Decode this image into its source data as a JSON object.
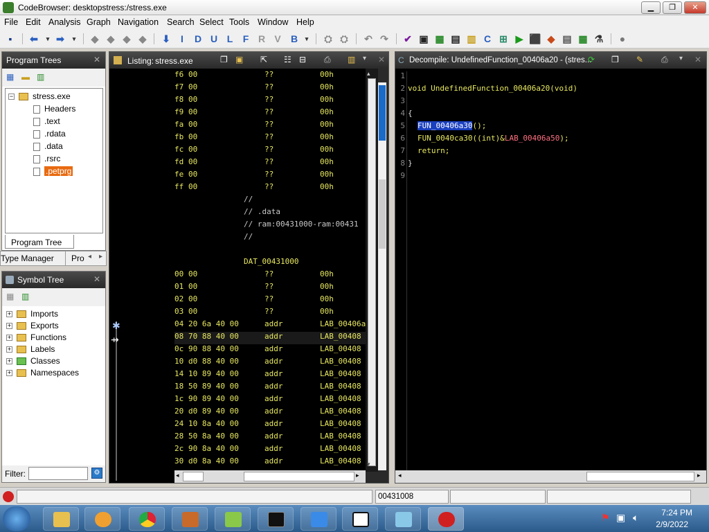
{
  "window": {
    "title": "CodeBrowser: desktopstress:/stress.exe"
  },
  "menu": [
    "File",
    "Edit",
    "Analysis",
    "Graph",
    "Navigation",
    "Search",
    "Select",
    "Tools",
    "Window",
    "Help"
  ],
  "toolbar": {
    "letter_buttons": [
      "I",
      "D",
      "U",
      "L",
      "F",
      "R",
      "V",
      "B"
    ]
  },
  "program_trees": {
    "title": "Program Trees",
    "root": "stress.exe",
    "items": [
      "Headers",
      ".text",
      ".rdata",
      ".data",
      ".rsrc",
      ".petprg"
    ],
    "tab_label": "Program Tree",
    "bottom_tabs": [
      "Type Manager",
      "Pro"
    ]
  },
  "symbol_tree": {
    "title": "Symbol Tree",
    "items": [
      "Imports",
      "Exports",
      "Functions",
      "Labels",
      "Classes",
      "Namespaces"
    ],
    "filter_label": "Filter:"
  },
  "listing": {
    "title": "Listing:",
    "file": "stress.exe",
    "rows": [
      {
        "addr": "f6",
        "bytes": "00",
        "mn": "??",
        "op": "00h"
      },
      {
        "addr": "f7",
        "bytes": "00",
        "mn": "??",
        "op": "00h"
      },
      {
        "addr": "f8",
        "bytes": "00",
        "mn": "??",
        "op": "00h"
      },
      {
        "addr": "f9",
        "bytes": "00",
        "mn": "??",
        "op": "00h"
      },
      {
        "addr": "fa",
        "bytes": "00",
        "mn": "??",
        "op": "00h"
      },
      {
        "addr": "fb",
        "bytes": "00",
        "mn": "??",
        "op": "00h"
      },
      {
        "addr": "fc",
        "bytes": "00",
        "mn": "??",
        "op": "00h"
      },
      {
        "addr": "fd",
        "bytes": "00",
        "mn": "??",
        "op": "00h"
      },
      {
        "addr": "fe",
        "bytes": "00",
        "mn": "??",
        "op": "00h"
      },
      {
        "addr": "ff",
        "bytes": "00",
        "mn": "??",
        "op": "00h"
      }
    ],
    "comments": [
      "//",
      "// .data",
      "// ram:00431000-ram:00431",
      "//"
    ],
    "label": "DAT_00431000",
    "rows2": [
      {
        "addr": "00",
        "bytes": "00",
        "mn": "??",
        "op": "00h"
      },
      {
        "addr": "01",
        "bytes": "00",
        "mn": "??",
        "op": "00h"
      },
      {
        "addr": "02",
        "bytes": "00",
        "mn": "??",
        "op": "00h"
      },
      {
        "addr": "03",
        "bytes": "00",
        "mn": "??",
        "op": "00h"
      },
      {
        "addr": "04",
        "bytes": "20 6a 40 00",
        "mn": "addr",
        "op": "LAB_00406a"
      },
      {
        "addr": "08",
        "bytes": "70 88 40 00",
        "mn": "addr",
        "op": "LAB_00408"
      },
      {
        "addr": "0c",
        "bytes": "90 88 40 00",
        "mn": "addr",
        "op": "LAB_00408"
      },
      {
        "addr": "10",
        "bytes": "d0 88 40 00",
        "mn": "addr",
        "op": "LAB_00408"
      },
      {
        "addr": "14",
        "bytes": "10 89 40 00",
        "mn": "addr",
        "op": "LAB_00408"
      },
      {
        "addr": "18",
        "bytes": "50 89 40 00",
        "mn": "addr",
        "op": "LAB_00408"
      },
      {
        "addr": "1c",
        "bytes": "90 89 40 00",
        "mn": "addr",
        "op": "LAB_00408"
      },
      {
        "addr": "20",
        "bytes": "d0 89 40 00",
        "mn": "addr",
        "op": "LAB_00408"
      },
      {
        "addr": "24",
        "bytes": "10 8a 40 00",
        "mn": "addr",
        "op": "LAB_00408"
      },
      {
        "addr": "28",
        "bytes": "50 8a 40 00",
        "mn": "addr",
        "op": "LAB_00408"
      },
      {
        "addr": "2c",
        "bytes": "90 8a 40 00",
        "mn": "addr",
        "op": "LAB_00408"
      },
      {
        "addr": "30",
        "bytes": "d0 8a 40 00",
        "mn": "addr",
        "op": "LAB_00408"
      }
    ]
  },
  "decompile": {
    "title": "Decompile: UndefinedFunction_00406a20 - (stres...",
    "line_numbers": [
      "1",
      "2",
      "3",
      "4",
      "5",
      "6",
      "7",
      "8",
      "9"
    ],
    "signature": "void UndefinedFunction_00406a20(void)",
    "open_brace": "{",
    "call1": "FUN_00406a30",
    "call1_tail": "();",
    "call2_fn": "FUN_0040ca30",
    "call2_cast": "((int)&",
    "call2_label": "LAB_00406a50",
    "call2_tail": ");",
    "ret": "return;",
    "close_brace": "}"
  },
  "status": {
    "address": "00431008"
  },
  "clock": {
    "time": "7:24 PM",
    "date": "2/9/2022"
  }
}
